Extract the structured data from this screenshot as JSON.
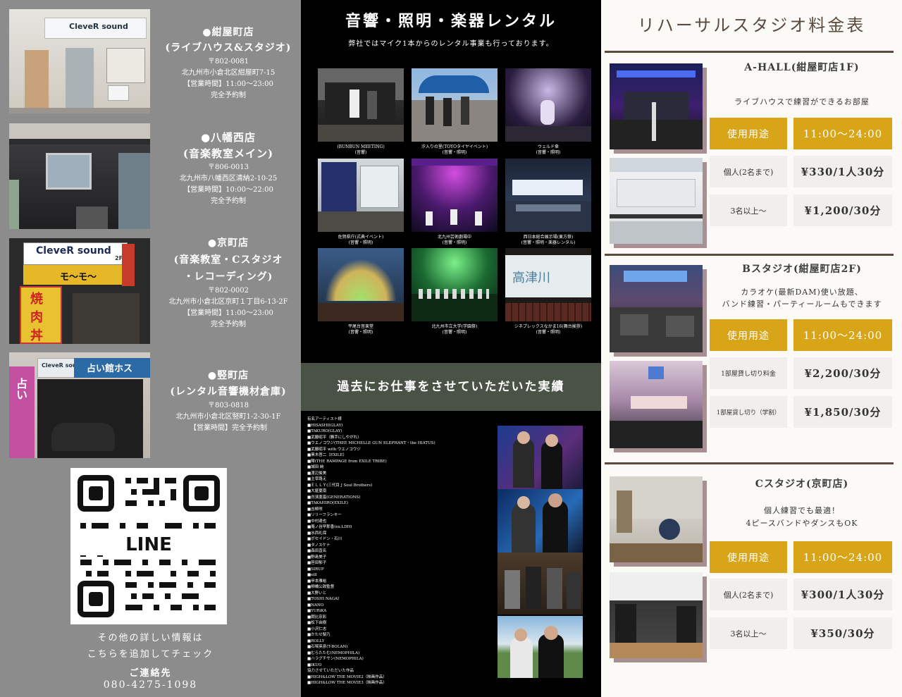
{
  "colors": {
    "gold": "#d9a518",
    "brown": "#5b4a3f",
    "green_band": "#4a5245",
    "grey_panel": "#8c8c8c"
  },
  "shops": [
    {
      "name": "●紺屋町店",
      "sub": [
        "(ライブハウス&スタジオ)"
      ],
      "lines": [
        "〒802-0081",
        "北九州市小倉北区紺屋町7-15",
        "【営業時間】11:00～23:00",
        "完全予約制"
      ]
    },
    {
      "name": "●八幡西店",
      "sub": [
        "(音楽教室メイン)"
      ],
      "lines": [
        "〒806-0013",
        "北九州市八幡西区清納2-10-25",
        "【営業時間】10:00～22:00",
        "完全予約制"
      ]
    },
    {
      "name": "●京町店",
      "sub": [
        "(音楽教室・Cスタジオ",
        "・レコーディング)"
      ],
      "lines": [
        "〒802-0002",
        "北九州市小倉北区京町１丁目6-13-2F",
        "【営業時間】11:00～23:00",
        "完全予約制"
      ]
    },
    {
      "name": "●竪町店",
      "sub": [
        "(レンタル音響機材倉庫)"
      ],
      "lines": [
        "〒803-0818",
        "北九州市小倉北区竪町1-2-30-1F",
        "【営業時間】完全予約制"
      ]
    }
  ],
  "signs": {
    "clever1": "CleveR sound",
    "clever3": "CleveR sound",
    "clever3_floor": "2F",
    "momo": "モ～モ～",
    "yaki": "焼",
    "niku": "肉",
    "don": "丼",
    "clever4": "CleveR sound",
    "uranai": "占い",
    "ura": "占い",
    "hoshi": "占い館ホス"
  },
  "qr": {
    "label": "LINE",
    "note1": "その他の詳しい情報は",
    "note2": "こちらを追加してチェック",
    "contact_label": "ご連絡先",
    "phone": "080-4275-1098"
  },
  "rental": {
    "title": "音響・照明・楽器レンタル",
    "subtitle": "弊社ではマイク1本からのレンタル事業も行っております。",
    "gallery": [
      {
        "cap1": "(BUNBUN MEETING)",
        "cap2": "(音響)"
      },
      {
        "cap1": "汐入りの里(TOYOタイヤイベント)",
        "cap2": "(音響・照明)"
      },
      {
        "cap1": "ウェルド傘",
        "cap2": "(音響・照明)"
      },
      {
        "cap1": "佐賀県庁(式典イベント)",
        "cap2": "(音響・照明)"
      },
      {
        "cap1": "北九州芸術劇場中",
        "cap2": "(音響・照明)"
      },
      {
        "cap1": "西日本総合展示場(東方祭)",
        "cap2": "(音響・照明・楽器レンタル)"
      },
      {
        "cap1": "平尾台音楽堂",
        "cap2": "(音響・照明)"
      },
      {
        "cap1": "北九州市立大学(学園祭)",
        "cap2": "(音響・照明)"
      },
      {
        "cap1": "シネプレックスなかま16(舞台挨拶)",
        "cap2": "(音響・照明)"
      }
    ],
    "screen_text": "高津川"
  },
  "works": {
    "title": "過去にお仕事をさせていただいた実績",
    "artists": [
      "有名アーティスト様",
      "■HISASHI(GLAY)",
      "■TAKURO(GLAY)",
      "■武藤昭平（勝手にしやがれ）",
      "■ウエノコウジ(THEE MICHELLE GUN ELEPHANT・the HIATUS)",
      "■武藤昭平 with ウエノコウジ",
      "■黒木啓二（EXILE）",
      "■陣(THE RAMPAGE from EXILE TRIBE)",
      "■城田 純",
      "■渡辺俊美",
      "■主宰路え",
      "■ＥＬＬＹ(三代目 J Soul Brothers)",
      "■大屋夏南",
      "■白濱亜嵐(GENERATIONS)",
      "■TAKAHIRO(EXILE)",
      "■吉柳咲",
      "■リリーフランキー",
      "■中村達也",
      "■庵ノ谷早那香(ex.LDH)",
      "■水西礼保",
      "■ボセイドン・石川",
      "■タノスケナ",
      "■森田直名",
      "■野島美子",
      "■笹田郁子",
      "■SIRUP",
      "■eill",
      "■甲本雅裕",
      "■柳橋公政監督",
      "■大野いと",
      "■TOSHI NAGAI",
      "■NANO",
      "■YURiKA",
      "■朝比奈彩",
      "■松下由樹",
      "■小沢仁志",
      "■かたせ梨乃",
      "■ROLLY",
      "■石塚英彦(T-BOLAN)",
      "■むらたたむ(NEMOPHILA)",
      "■ハラグチサン(NEMOPHILA)",
      "■IKUO",
      "協力させていただいた作品",
      "■HIGH&LOW THE MOVIE2（映画作品）",
      "■HIGH&LOW THE MOVIE3（映画作品）"
    ]
  },
  "price": {
    "title": "リハーサルスタジオ料金表",
    "rooms": [
      {
        "title": "A-HALL(紺屋町店1F)",
        "desc": [
          "ライブハウスで練習ができるお部屋"
        ],
        "usage_label": "使用用途",
        "hours": "11:00～24:00",
        "rows": [
          {
            "label": "個人(2名まで)",
            "price": "¥330/1人30分"
          },
          {
            "label": "3名以上～",
            "price": "¥1,200/30分"
          }
        ]
      },
      {
        "title": "Bスタジオ(紺屋町店2F)",
        "desc": [
          "カラオケ(最新DAM)使い放題、",
          "バンド練習・パーティールームもできます"
        ],
        "usage_label": "使用用途",
        "hours": "11:00～24:00",
        "rows": [
          {
            "label": "1部屋貸し切り料金",
            "price": "¥2,200/30分"
          },
          {
            "label": "1部屋貸し切り（学割）",
            "price": "¥1,850/30分"
          }
        ]
      },
      {
        "title": "Cスタジオ(京町店)",
        "desc": [
          "個人練習でも最適！",
          "4ピースバンドやダンスもOK"
        ],
        "usage_label": "使用用途",
        "hours": "11:00～24:00",
        "rows": [
          {
            "label": "個人(2名まで)",
            "price": "¥300/1人30分"
          },
          {
            "label": "3名以上～",
            "price": "¥350/30分"
          }
        ]
      }
    ]
  }
}
